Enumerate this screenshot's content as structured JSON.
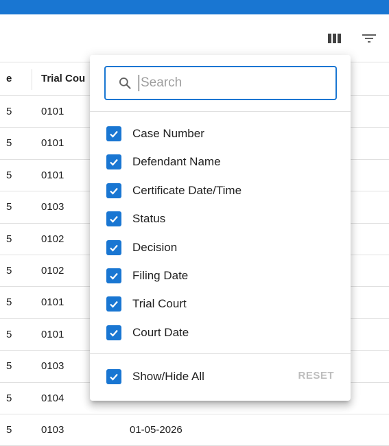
{
  "toolbar": {
    "columns_icon": "view-column-icon",
    "filter_icon": "filter-list-icon"
  },
  "grid": {
    "headers": [
      "e",
      "Trial Cou"
    ],
    "rows": [
      [
        "5",
        "0101",
        ""
      ],
      [
        "5",
        "0101",
        ""
      ],
      [
        "5",
        "0101",
        ""
      ],
      [
        "5",
        "0103",
        ""
      ],
      [
        "5",
        "0102",
        ""
      ],
      [
        "5",
        "0102",
        ""
      ],
      [
        "5",
        "0101",
        ""
      ],
      [
        "5",
        "0101",
        ""
      ],
      [
        "5",
        "0103",
        ""
      ],
      [
        "5",
        "0104",
        ""
      ],
      [
        "5",
        "0103",
        "01-05-2026"
      ]
    ]
  },
  "columns_panel": {
    "search": {
      "placeholder": "Search",
      "value": ""
    },
    "options": [
      {
        "label": "Case Number",
        "checked": true
      },
      {
        "label": "Defendant Name",
        "checked": true
      },
      {
        "label": "Certificate Date/Time",
        "checked": true
      },
      {
        "label": "Status",
        "checked": true
      },
      {
        "label": "Decision",
        "checked": true
      },
      {
        "label": "Filing Date",
        "checked": true
      },
      {
        "label": "Trial Court",
        "checked": true
      },
      {
        "label": "Court Date",
        "checked": true
      }
    ],
    "show_hide_all": {
      "label": "Show/Hide All",
      "checked": true
    },
    "reset_label": "RESET"
  },
  "colors": {
    "accent": "#1976d2",
    "disabled": "#bdbdbd"
  }
}
